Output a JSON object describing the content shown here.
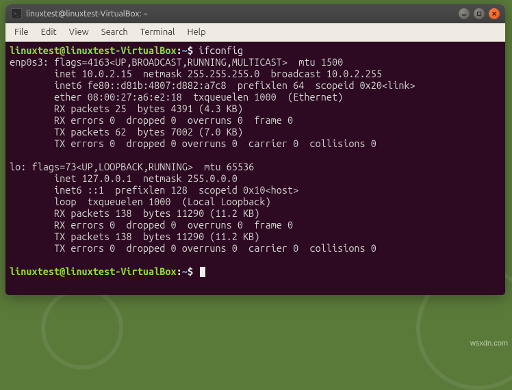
{
  "window": {
    "title": "linuxtest@linuxtest-VirtualBox: ~"
  },
  "menubar": {
    "items": [
      "File",
      "Edit",
      "View",
      "Search",
      "Terminal",
      "Help"
    ]
  },
  "prompt": {
    "user_host": "linuxtest@linuxtest-VirtualBox",
    "sep": ":",
    "path": "~",
    "end": "$"
  },
  "session": {
    "cmd1": "ifconfig",
    "out_lines": [
      "enp0s3: flags=4163<UP,BROADCAST,RUNNING,MULTICAST>  mtu 1500",
      "        inet 10.0.2.15  netmask 255.255.255.0  broadcast 10.0.2.255",
      "        inet6 fe80::d81b:4807:d882:a7c8  prefixlen 64  scopeid 0x20<link>",
      "        ether 08:00:27:a6:e2:18  txqueuelen 1000  (Ethernet)",
      "        RX packets 25  bytes 4391 (4.3 KB)",
      "        RX errors 0  dropped 0  overruns 0  frame 0",
      "        TX packets 62  bytes 7002 (7.0 KB)",
      "        TX errors 0  dropped 0 overruns 0  carrier 0  collisions 0",
      "",
      "lo: flags=73<UP,LOOPBACK,RUNNING>  mtu 65536",
      "        inet 127.0.0.1  netmask 255.0.0.0",
      "        inet6 ::1  prefixlen 128  scopeid 0x10<host>",
      "        loop  txqueuelen 1000  (Local Loopback)",
      "        RX packets 138  bytes 11290 (11.2 KB)",
      "        RX errors 0  dropped 0  overruns 0  frame 0",
      "        TX packets 138  bytes 11290 (11.2 KB)",
      "        TX errors 0  dropped 0 overruns 0  carrier 0  collisions 0",
      ""
    ]
  },
  "watermark": "wsxdn.com"
}
